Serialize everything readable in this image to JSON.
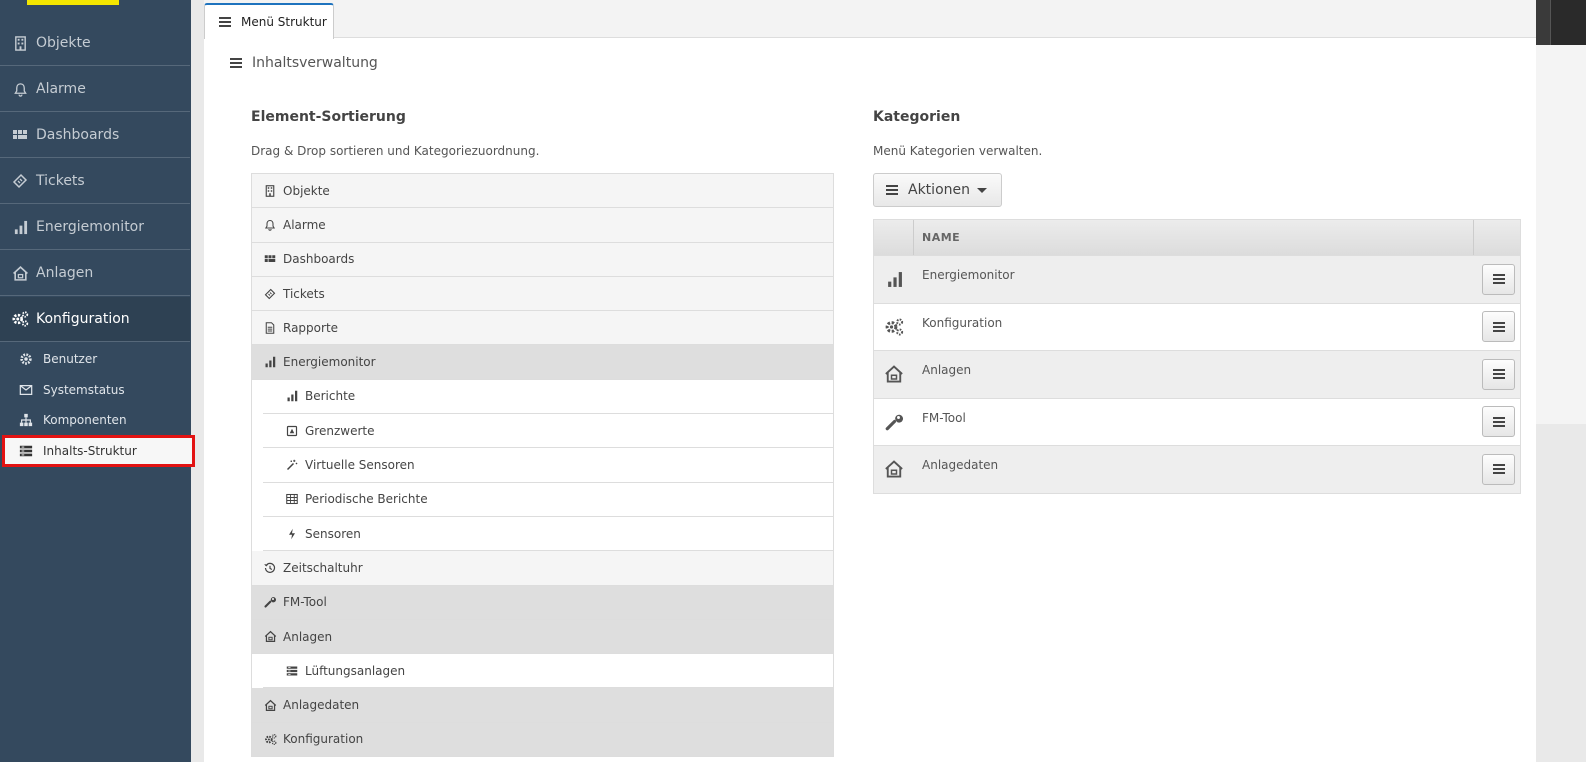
{
  "sidebar": {
    "items": [
      {
        "label": "Objekte",
        "icon": "building-icon"
      },
      {
        "label": "Alarme",
        "icon": "bell-icon"
      },
      {
        "label": "Dashboards",
        "icon": "dashboard-icon"
      },
      {
        "label": "Tickets",
        "icon": "ticket-icon"
      },
      {
        "label": "Energiemonitor",
        "icon": "bar-chart-icon"
      },
      {
        "label": "Anlagen",
        "icon": "house-icon"
      },
      {
        "label": "Konfiguration",
        "icon": "gears-icon"
      }
    ],
    "subitems": [
      {
        "label": "Benutzer",
        "icon": "gear-icon"
      },
      {
        "label": "Systemstatus",
        "icon": "status-icon"
      },
      {
        "label": "Komponenten",
        "icon": "sitemap-icon"
      },
      {
        "label": "Inhalts-Struktur",
        "icon": "list-icon"
      }
    ]
  },
  "tab": {
    "label": "Menü Struktur"
  },
  "breadcrumb": {
    "label": "Inhaltsverwaltung"
  },
  "sorting": {
    "title": "Element-Sortierung",
    "subtitle": "Drag & Drop sortieren und Kategoriezuordnung.",
    "rows": [
      {
        "label": "Objekte",
        "icon": "building-icon"
      },
      {
        "label": "Alarme",
        "icon": "bell-icon"
      },
      {
        "label": "Dashboards",
        "icon": "dashboard-icon"
      },
      {
        "label": "Tickets",
        "icon": "ticket-icon"
      },
      {
        "label": "Rapporte",
        "icon": "document-icon"
      },
      {
        "label": "Energiemonitor",
        "icon": "bar-chart-icon"
      },
      {
        "label": "Berichte",
        "icon": "bar-chart-icon"
      },
      {
        "label": "Grenzwerte",
        "icon": "limit-icon"
      },
      {
        "label": "Virtuelle Sensoren",
        "icon": "magic-icon"
      },
      {
        "label": "Periodische Berichte",
        "icon": "table-icon"
      },
      {
        "label": "Sensoren",
        "icon": "bolt-icon"
      },
      {
        "label": "Zeitschaltuhr",
        "icon": "clock-icon"
      },
      {
        "label": "FM-Tool",
        "icon": "wrench-icon"
      },
      {
        "label": "Anlagen",
        "icon": "house-icon"
      },
      {
        "label": "Lüftungsanlagen",
        "icon": "list-icon"
      },
      {
        "label": "Anlagedaten",
        "icon": "house-icon"
      },
      {
        "label": "Konfiguration",
        "icon": "gears-icon"
      }
    ]
  },
  "categories": {
    "title": "Kategorien",
    "subtitle": "Menü Kategorien verwalten.",
    "actions_label": "Aktionen",
    "column_name": "NAME",
    "rows": [
      {
        "label": "Energiemonitor",
        "icon": "bar-chart-icon"
      },
      {
        "label": "Konfiguration",
        "icon": "gears-icon"
      },
      {
        "label": "Anlagen",
        "icon": "house-icon"
      },
      {
        "label": "FM-Tool",
        "icon": "wrench-icon"
      },
      {
        "label": "Anlagedaten",
        "icon": "house-icon"
      }
    ]
  }
}
